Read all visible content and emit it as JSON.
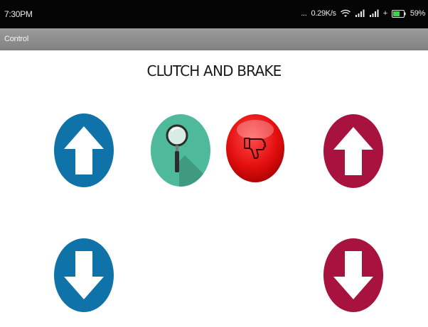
{
  "status_bar": {
    "time": "7:30PM",
    "network_speed": "0.29K/s",
    "battery_percent": "59%",
    "icons": [
      "wifi-icon",
      "signal-icon",
      "signal-icon",
      "battery-icon"
    ]
  },
  "action_bar": {
    "title": "Control"
  },
  "page": {
    "title": "CLUTCH AND BRAKE"
  },
  "buttons": [
    {
      "name": "clutch-up-button",
      "icon": "arrow-up-icon",
      "color": "#0f72a9"
    },
    {
      "name": "search-button",
      "icon": "magnifier-icon",
      "color": "#4fb99b"
    },
    {
      "name": "dislike-button",
      "icon": "thumbs-down-icon",
      "color": "#e11212"
    },
    {
      "name": "brake-up-button",
      "icon": "arrow-up-icon",
      "color": "#a8123f"
    },
    {
      "name": "clutch-down-button",
      "icon": "arrow-down-icon",
      "color": "#0f72a9"
    },
    {
      "name": "brake-down-button",
      "icon": "arrow-down-icon",
      "color": "#a8123f"
    }
  ]
}
